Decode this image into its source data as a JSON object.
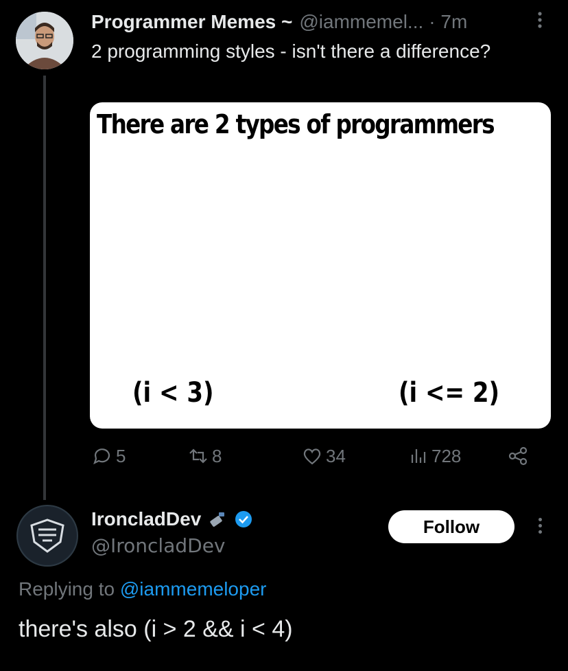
{
  "tweet": {
    "author_name": "Programmer Memes ~",
    "handle": "@iammemel...",
    "time": "· 7m",
    "text": "2 programming styles - isn't there a difference?",
    "meme": {
      "title": "There are 2 types of programmers",
      "left": "(i < 3)",
      "right": "(i <= 2)"
    },
    "stats": {
      "replies": "5",
      "retweets": "8",
      "likes": "34",
      "views": "728"
    }
  },
  "reply": {
    "author_name": "IroncladDev",
    "handle": "@IroncladDev",
    "follow_label": "Follow",
    "replying_prefix": "Replying to",
    "replying_mention": "@iammemeloper",
    "text": "there's also (i > 2 && i < 4)"
  },
  "colors": {
    "background": "#000000",
    "muted": "#71767b",
    "link": "#1d9bf0",
    "verified": "#1d9bf0"
  }
}
